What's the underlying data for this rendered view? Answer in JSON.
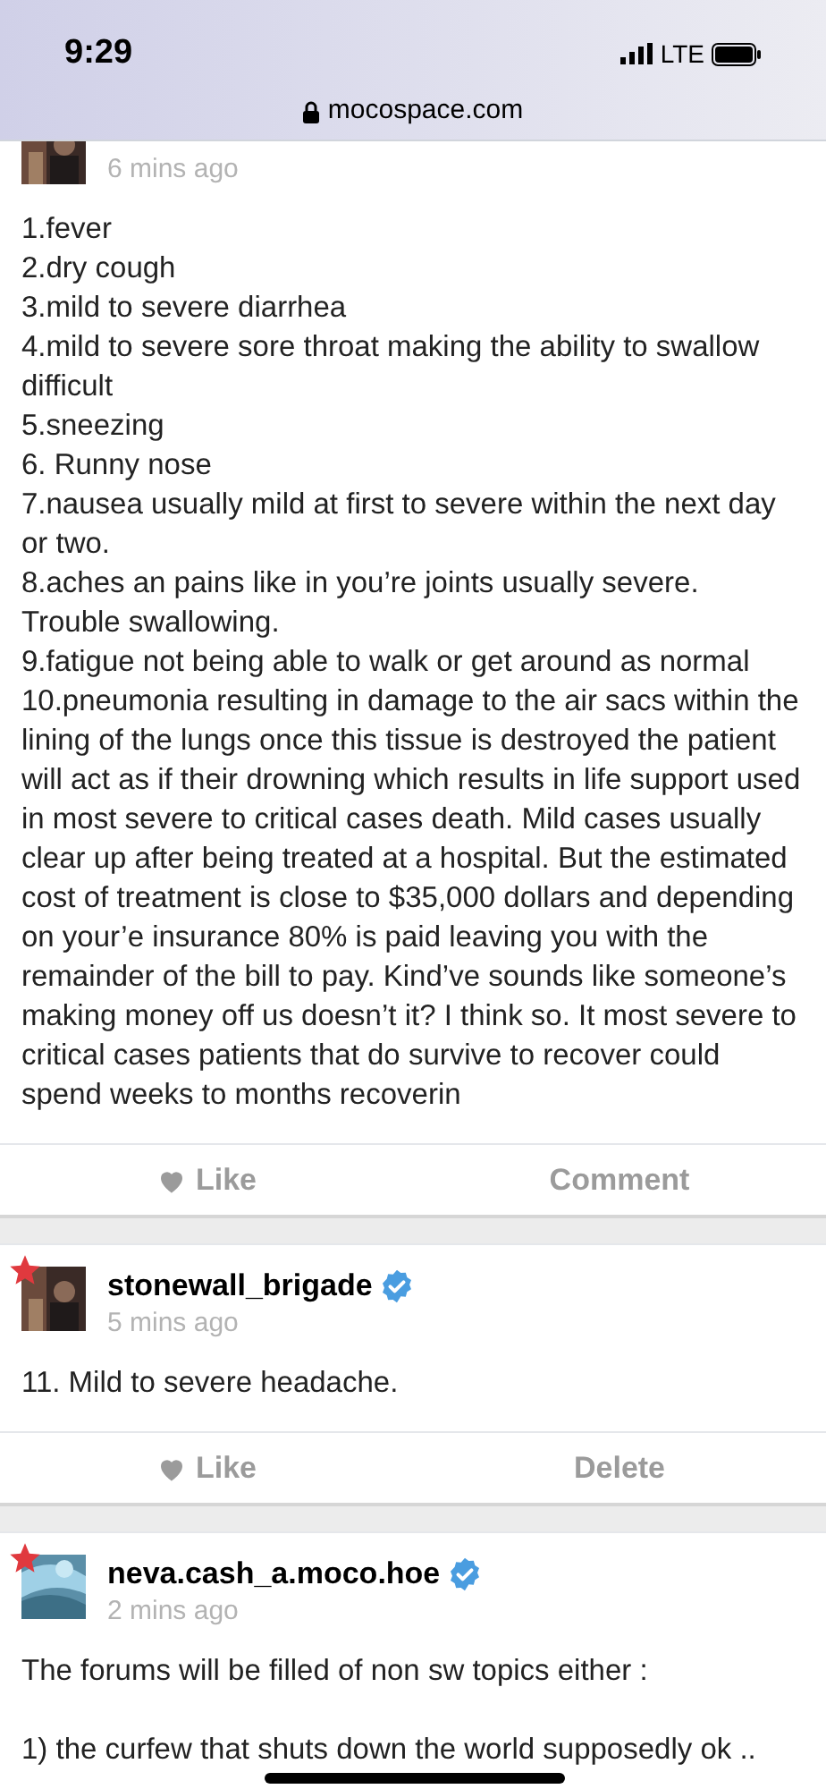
{
  "status_bar": {
    "time": "9:29",
    "network": "LTE"
  },
  "address_bar": {
    "url": "mocospace.com"
  },
  "posts": [
    {
      "time": "6 mins ago",
      "body": [
        "1.fever",
        "2.dry cough",
        "3.mild to severe diarrhea",
        "4.mild to severe sore throat making the ability to swallow difficult",
        "5.sneezing",
        "6. Runny nose",
        "7.nausea usually mild at first to severe within the next day or two.",
        "8.aches an pains like in you’re joints usually severe. Trouble swallowing.",
        "9.fatigue not being able to walk or get around as normal",
        "10.pneumonia resulting in damage to the air sacs within the lining of the lungs once this tissue is destroyed the patient will act as if their drowning which results in life support used in most severe to critical cases death. Mild cases usually clear up after being treated at a hospital. But the estimated cost of treatment is close to $35,000 dollars and depending on your’e insurance 80% is paid leaving you with the remainder of the bill to pay. Kind’ve sounds like someone’s making money off us doesn’t it? I think so. It most severe to critical cases patients that do survive to recover could spend weeks to months recoverin"
      ],
      "actions": [
        "Like",
        "Comment"
      ]
    },
    {
      "username": "stonewall_brigade",
      "time": "5 mins ago",
      "verified": true,
      "starred": true,
      "body": [
        "11. Mild to severe headache."
      ],
      "actions": [
        "Like",
        "Delete"
      ]
    },
    {
      "username": "neva.cash_a.moco.hoe",
      "time": "2 mins ago",
      "verified": true,
      "starred": true,
      "body": [
        "The forums will be filled of non sw topics either :",
        "1) the curfew that shuts down the world supposedly ok .."
      ]
    }
  ]
}
